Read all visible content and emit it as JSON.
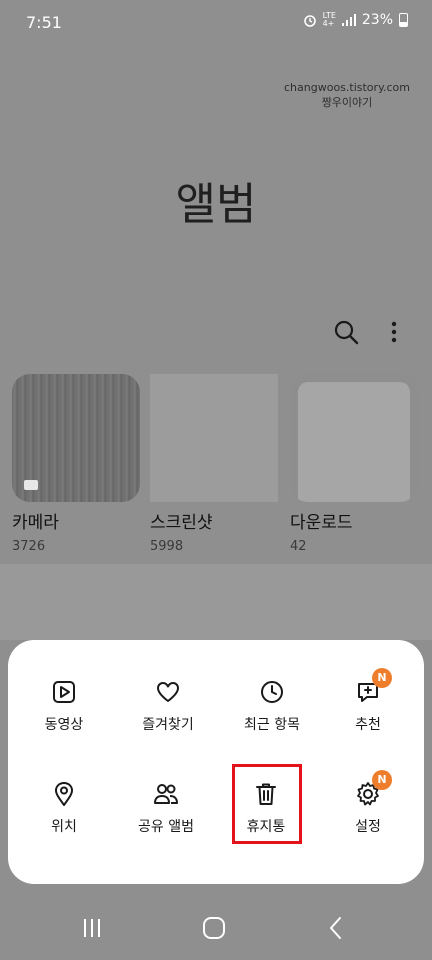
{
  "status_bar": {
    "time": "7:51",
    "network": "LTE",
    "network_sub": "4+",
    "battery": "23%"
  },
  "watermark": {
    "line1": "changwoos.tistory.com",
    "line2": "짱우이야기"
  },
  "header": {
    "title": "앨범"
  },
  "toolbar": {
    "icons": [
      "search-icon",
      "more-vert-icon"
    ]
  },
  "albums": [
    {
      "name": "카메라",
      "count": "3726"
    },
    {
      "name": "스크린샷",
      "count": "5998"
    },
    {
      "name": "다운로드",
      "count": "42"
    }
  ],
  "menu": {
    "items": [
      {
        "label": "동영상",
        "icon": "play-video-icon"
      },
      {
        "label": "즐겨찾기",
        "icon": "heart-icon"
      },
      {
        "label": "최근 항목",
        "icon": "clock-icon"
      },
      {
        "label": "추천",
        "icon": "suggest-icon",
        "badge": "N"
      },
      {
        "label": "위치",
        "icon": "location-pin-icon"
      },
      {
        "label": "공유 앨범",
        "icon": "people-icon"
      },
      {
        "label": "휴지통",
        "icon": "trash-icon"
      },
      {
        "label": "설정",
        "icon": "gear-icon",
        "badge": "N"
      }
    ]
  },
  "colors": {
    "badge": "#ee7d2c",
    "highlight": "#e3121b",
    "scrim": "#8f8f8f"
  }
}
